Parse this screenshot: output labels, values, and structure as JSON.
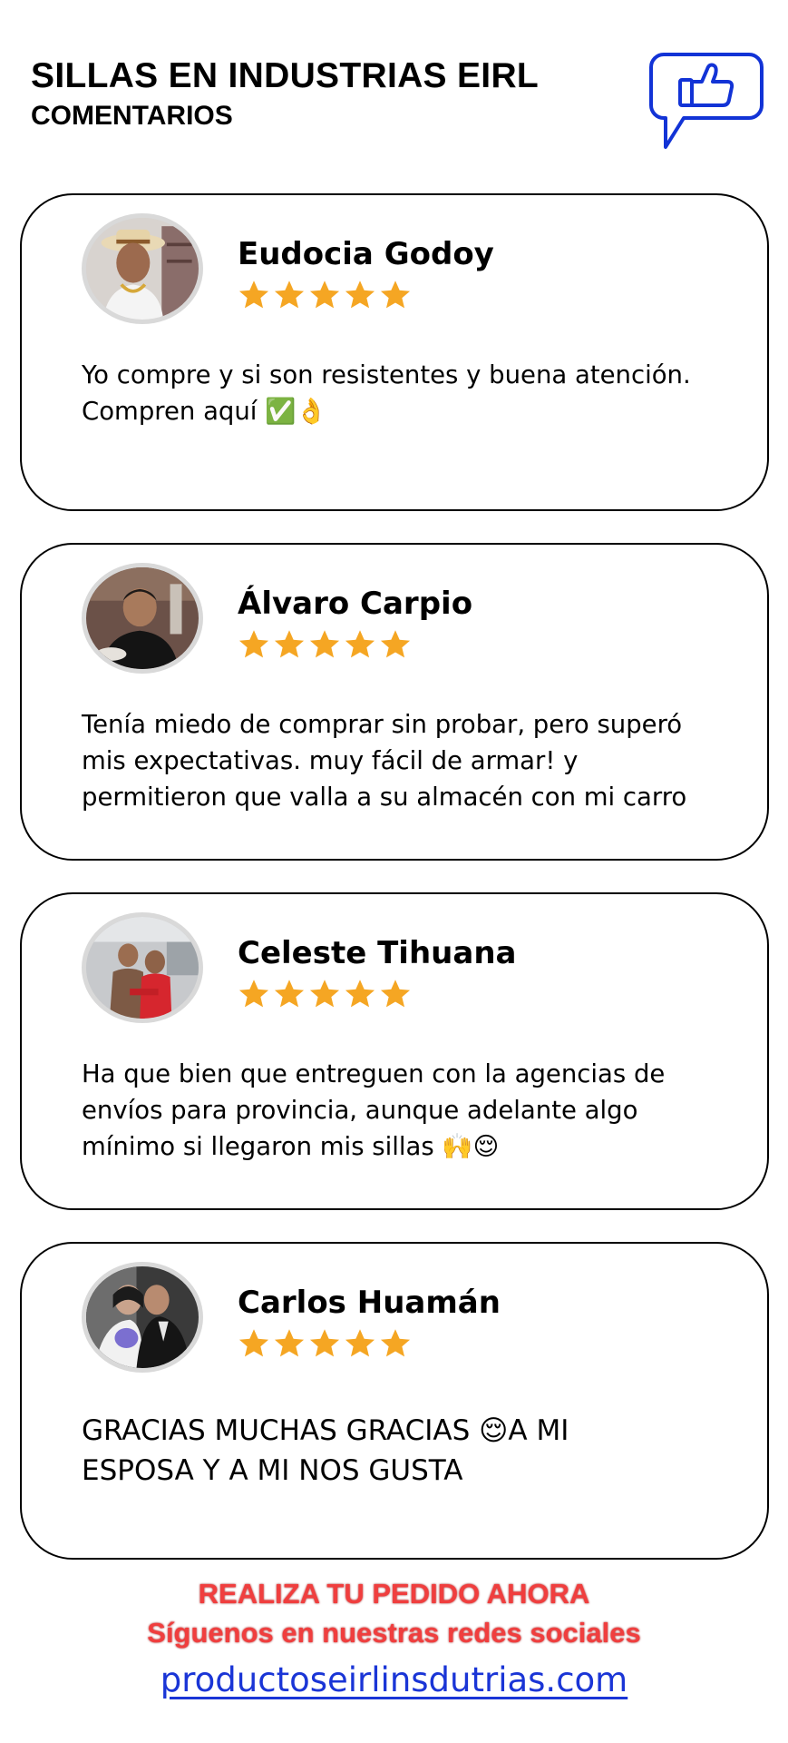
{
  "header": {
    "title": "SILLAS EN INDUSTRIAS EIRL",
    "subtitle": "COMENTARIOS",
    "icon": "thumbs-up-speech-bubble-icon",
    "icon_color": "#1233d6"
  },
  "reviews": [
    {
      "name": "Eudocia  Godoy",
      "rating": 5,
      "text": "Yo compre y si son resistentes y buena atención.\nCompren aquí ✅👌"
    },
    {
      "name": "Álvaro Carpio",
      "rating": 5,
      "text": "Tenía miedo de comprar sin probar, pero superó\nmis expectativas. muy fácil de armar! y\npermitieron que valla a su almacén con mi carro"
    },
    {
      "name": "Celeste Tihuana",
      "rating": 5,
      "text": "Ha que bien que entreguen con la agencias de\nenvíos para provincia, aunque adelante algo\nmínimo si llegaron mis sillas 🙌😌"
    },
    {
      "name": "Carlos Huamán",
      "rating": 5,
      "text": "GRACIAS MUCHAS GRACIAS 😌A MI\nESPOSA Y A MI NOS GUSTA"
    }
  ],
  "footer": {
    "cta_line1": "REALIZA TU PEDIDO AHORA",
    "cta_line2": "Síguenos en nuestras redes sociales",
    "website": "productoseirlinsdutrias.com",
    "cta_color": "#f03e3e",
    "link_color": "#1a35d6"
  },
  "colors": {
    "star": "#f5a623",
    "card_border": "#000000"
  }
}
